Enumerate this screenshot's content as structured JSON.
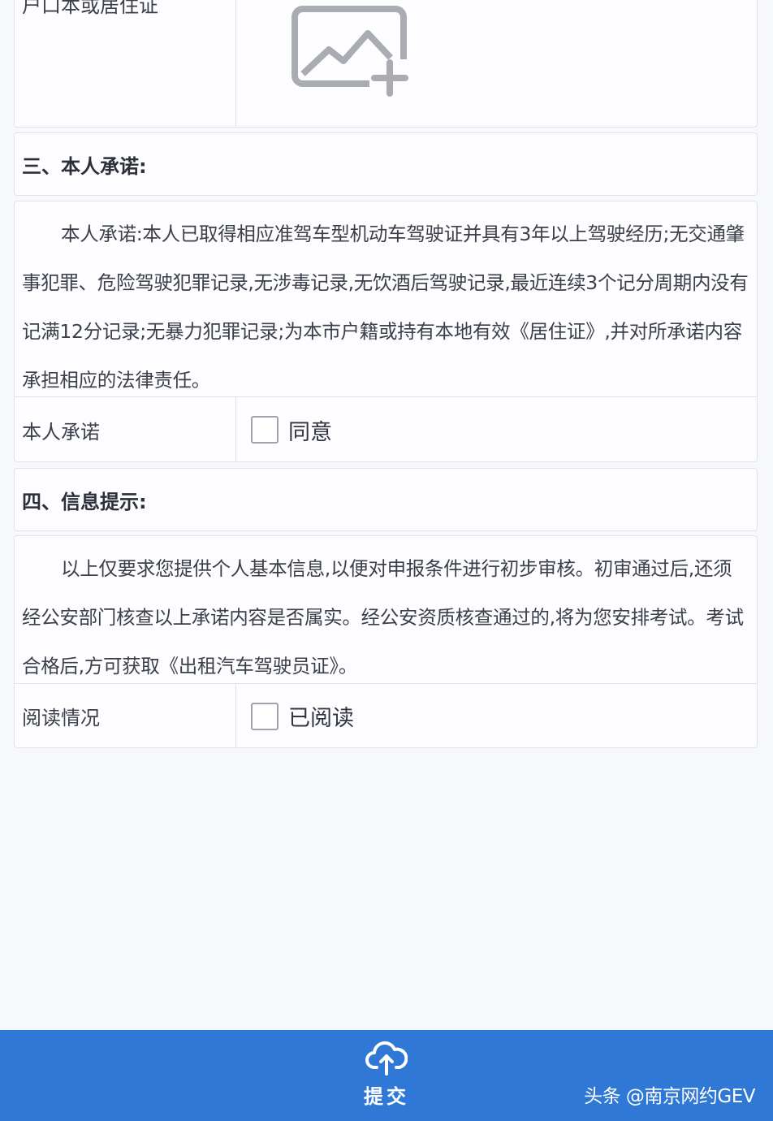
{
  "upload_row": {
    "label": "户口本或居住证"
  },
  "section3": {
    "title": "三、本人承诺:"
  },
  "commitment": {
    "text": "本人承诺:本人已取得相应准驾车型机动车驾驶证并具有3年以上驾驶经历;无交通肇事犯罪、危险驾驶犯罪记录,无涉毒记录,无饮酒后驾驶记录,最近连续3个记分周期内没有记满12分记录;无暴力犯罪记录;为本市户籍或持有本地有效《居住证》,并对所承诺内容承担相应的法律责任。",
    "row_label": "本人承诺",
    "checkbox_label": "同意"
  },
  "section4": {
    "title": "四、信息提示:"
  },
  "info": {
    "text": "以上仅要求您提供个人基本信息,以便对申报条件进行初步审核。初审通过后,还须经公安部门核查以上承诺内容是否属实。经公安资质核查通过的,将为您安排考试。考试合格后,方可获取《出租汽车驾驶员证》。",
    "row_label": "阅读情况",
    "checkbox_label": "已阅读"
  },
  "footer": {
    "submit_label": "提交",
    "submit_icon": "cloud-upload-icon",
    "watermark": "头条 @南京网约GEV"
  },
  "colors": {
    "primary": "#2f78d6",
    "border": "#dfe2ea",
    "background": "#f7f8fc"
  }
}
